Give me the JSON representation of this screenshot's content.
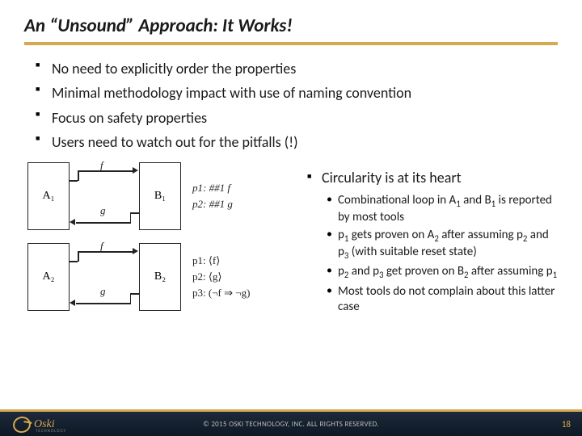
{
  "title": "An “Unsound” Approach: It Works!",
  "bullets": [
    "No need to explicitly order the properties",
    "Minimal methodology impact with use of naming convention",
    "Focus on safety properties",
    "Users need to watch out for the pitfalls (!)"
  ],
  "diagrams": {
    "row1": {
      "boxA": "A₁",
      "boxB": "B₁",
      "arrowF": "f",
      "arrowG": "g",
      "props": {
        "p1": "p1:  ##1 f",
        "p2": "p2:  ##1 g"
      }
    },
    "row2": {
      "boxA": "A₂",
      "boxB": "B₂",
      "arrowF": "f",
      "arrowG": "g",
      "props": {
        "p1": "p1:  ⟨f⟩",
        "p2": "p2:  ⟨g⟩",
        "p3": "p3:  (¬f ⇒ ¬g)"
      }
    }
  },
  "right": {
    "heading": "Circularity is at its heart",
    "sub": {
      "s1": {
        "pre": "Combinational loop in A",
        "a": "1",
        "mid": " and B",
        "b": "1",
        "post": " is reported by most tools"
      },
      "s2": {
        "pre": "p",
        "a": "1",
        "mid": " gets proven on A",
        "b": "2",
        "mid2": " after assuming p",
        "c": "2",
        "mid3": " and p",
        "d": "3",
        "post": " (with suitable reset state)"
      },
      "s3": {
        "pre": "p",
        "a": "2",
        "mid": " and p",
        "b": "3",
        "mid2": " get proven on B",
        "c": "2",
        "mid3": " after assuming p",
        "d": "1",
        "post": ""
      },
      "s4": "Most tools do not complain about this latter case"
    }
  },
  "footer": {
    "copyright": "© 2015 OSKI TECHNOLOGY, INC.  ALL RIGHTS RESERVED.",
    "page": "18",
    "logo_text": "Oski",
    "logo_sub": "TECHNOLOGY"
  }
}
